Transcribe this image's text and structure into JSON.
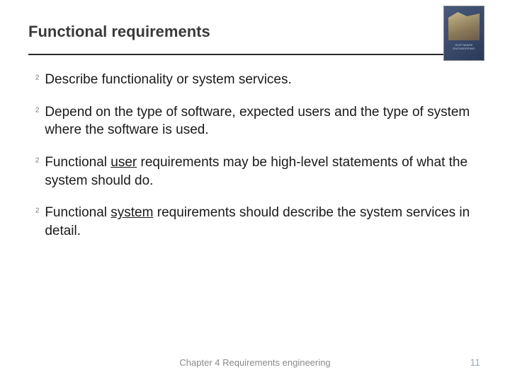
{
  "header": {
    "title": "Functional requirements",
    "cover_alt": "Software Engineering book cover"
  },
  "bullets": [
    {
      "pre": "Describe functionality or system services.",
      "u": "",
      "post": ""
    },
    {
      "pre": "Depend on the type of software, expected users and the type of system where the software is used.",
      "u": "",
      "post": ""
    },
    {
      "pre": "Functional ",
      "u": "user",
      "post": " requirements may be high-level statements of what the system should do."
    },
    {
      "pre": "Functional ",
      "u": "system",
      "post": " requirements should describe the system services in detail."
    }
  ],
  "footer": {
    "chapter": "Chapter 4 Requirements engineering",
    "page": "11"
  },
  "marker": "²"
}
